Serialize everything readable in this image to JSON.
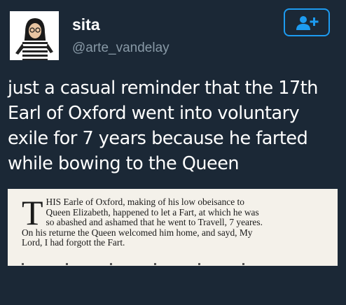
{
  "user": {
    "display_name": "sita",
    "handle": "@arte_vandelay",
    "avatar_icon": "avatar-icon"
  },
  "follow_button": {
    "icon": "add-user-icon",
    "accent": "#1d9bf0"
  },
  "tweet": {
    "text": "just a casual reminder that the 17th Earl of Oxford went into voluntary exile for 7 years because he farted while bowing to the Queen"
  },
  "media": {
    "dropcap": "T",
    "lines": [
      "HIS Earle of Oxford, making of his low obeisance to",
      "Queen Elizabeth, happened to let a Fart, at which he was",
      "so abashed and ashamed that he went to Travell, 7 yeares.",
      "On his returne the Queen welcomed him home, and sayd, My",
      "Lord, I had forgott the Fart."
    ]
  },
  "colors": {
    "background": "#1b2836",
    "handle": "#8899a6",
    "text": "#ffffff",
    "paper": "#f4f1ea"
  }
}
